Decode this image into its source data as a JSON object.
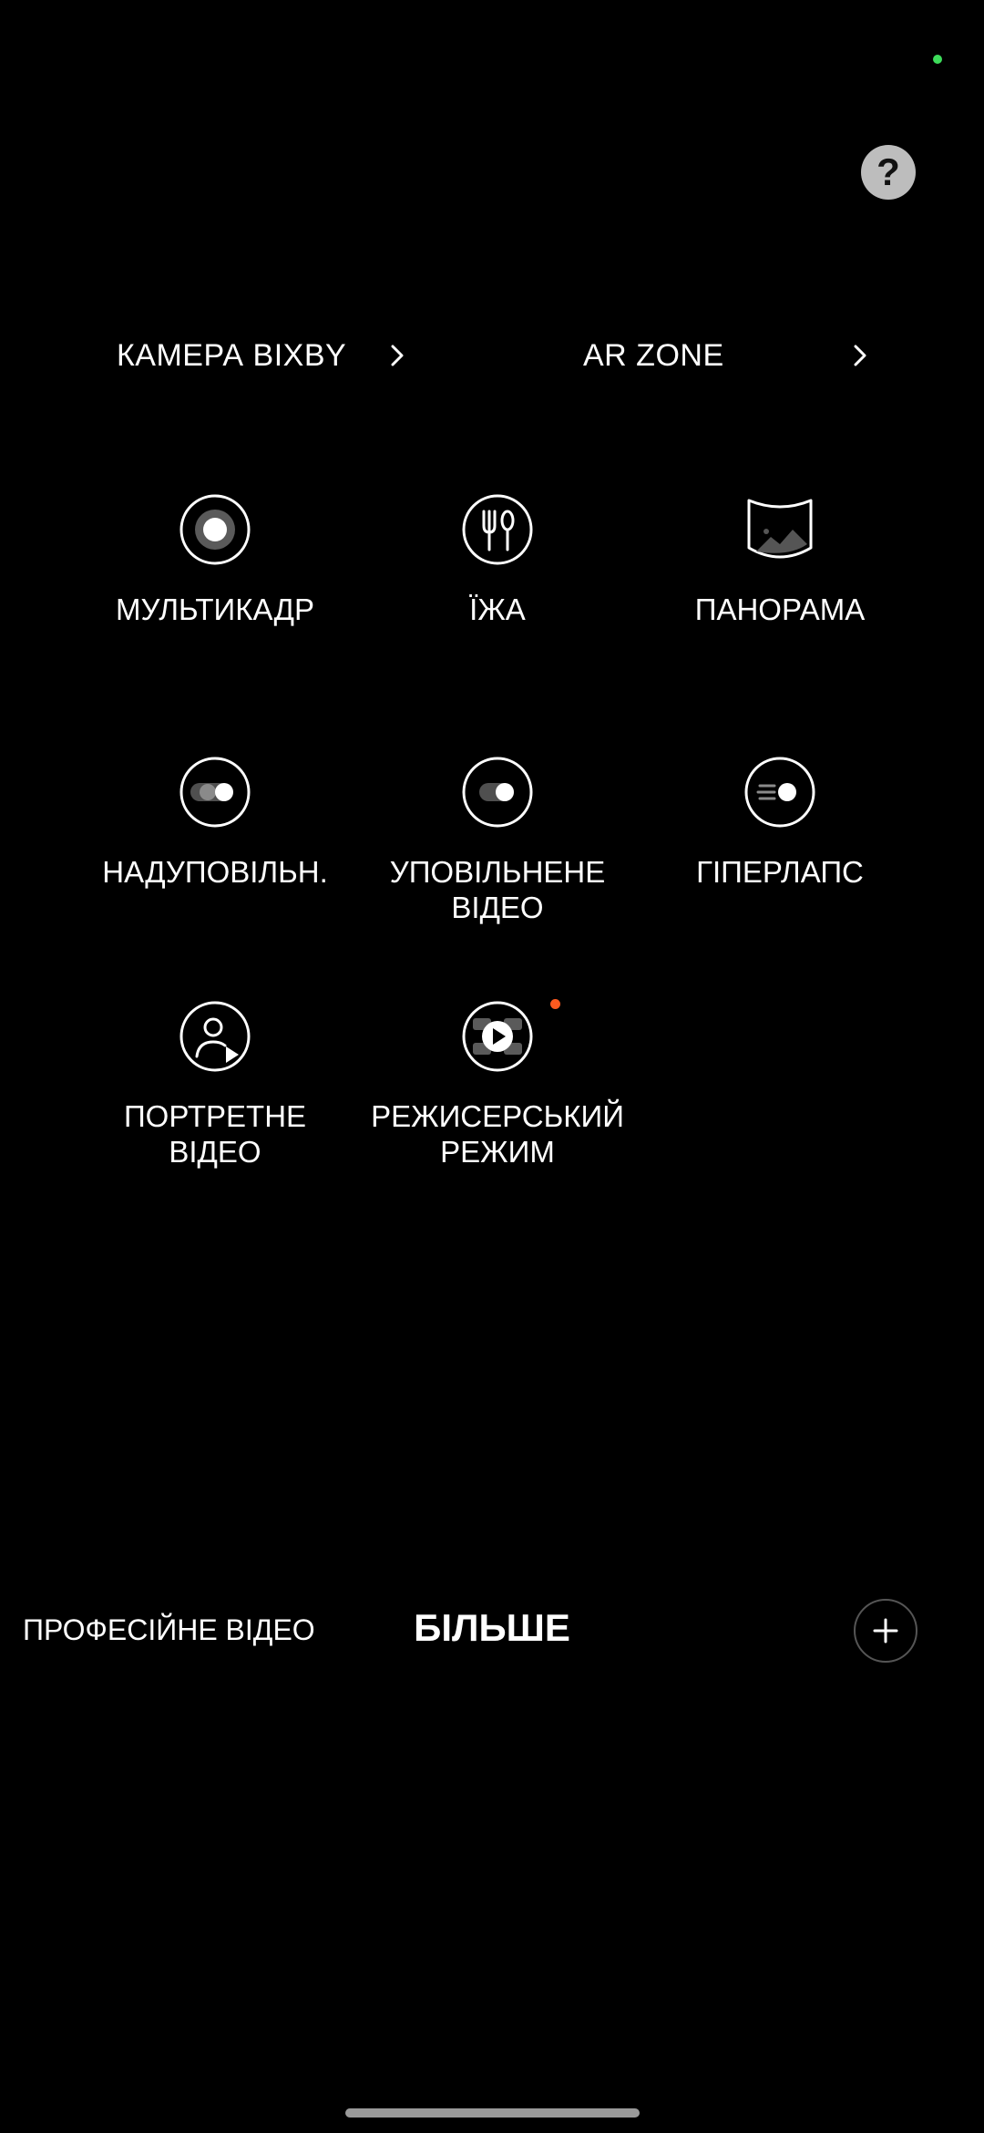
{
  "top_links": [
    {
      "label": "КАМЕРА BIXBY"
    },
    {
      "label": "AR ZONE"
    }
  ],
  "help": {
    "label": "?"
  },
  "modes": [
    {
      "label": "МУЛЬТИКАДР",
      "icon": "multi-frame-icon"
    },
    {
      "label": "ЇЖА",
      "icon": "food-icon"
    },
    {
      "label": "ПАНОРАМА",
      "icon": "panorama-icon"
    },
    {
      "label": "НАДУПОВІЛЬН.",
      "icon": "super-slow-mo-icon"
    },
    {
      "label": "УПОВІЛЬНЕНЕ\nВІДЕО",
      "icon": "slow-motion-icon"
    },
    {
      "label": "ГІПЕРЛАПС",
      "icon": "hyperlapse-icon"
    },
    {
      "label": "ПОРТРЕТНЕ\nВІДЕО",
      "icon": "portrait-video-icon"
    },
    {
      "label": "РЕЖИСЕРСЬКИЙ\nРЕЖИМ",
      "icon": "directors-view-icon"
    }
  ],
  "bottom_bar": {
    "left_mode": "ПРОФЕСІЙНЕ ВІДЕО",
    "active_mode": "БІЛЬШЕ",
    "add_icon": "plus-icon"
  },
  "colors": {
    "background": "#000000",
    "new_badge": "#ff5a1f",
    "status_dot": "#3ddc5a"
  }
}
